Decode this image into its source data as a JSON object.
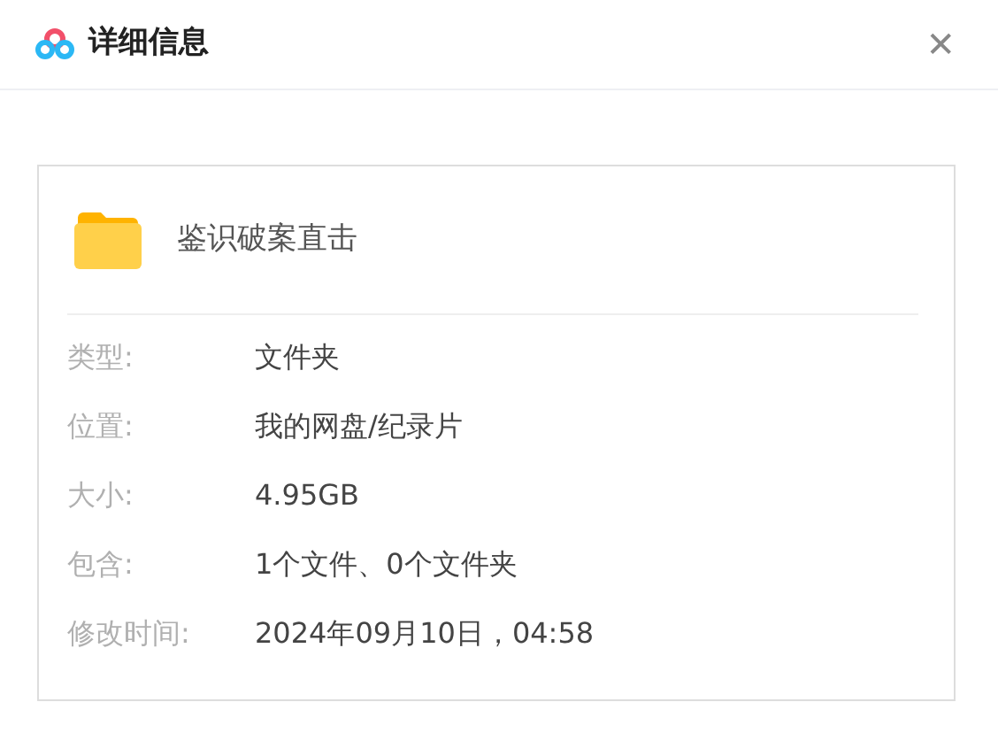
{
  "window": {
    "title": "详细信息",
    "close": "✕"
  },
  "file": {
    "name": "鉴识破案直击"
  },
  "details": [
    {
      "label": "类型:",
      "value": "文件夹"
    },
    {
      "label": "位置:",
      "value": "我的网盘/纪录片"
    },
    {
      "label": "大小:",
      "value": "4.95GB"
    },
    {
      "label": "包含:",
      "value": "1个文件、0个文件夹"
    },
    {
      "label": "修改时间:",
      "value": "2024年09月10日，04:58"
    }
  ]
}
